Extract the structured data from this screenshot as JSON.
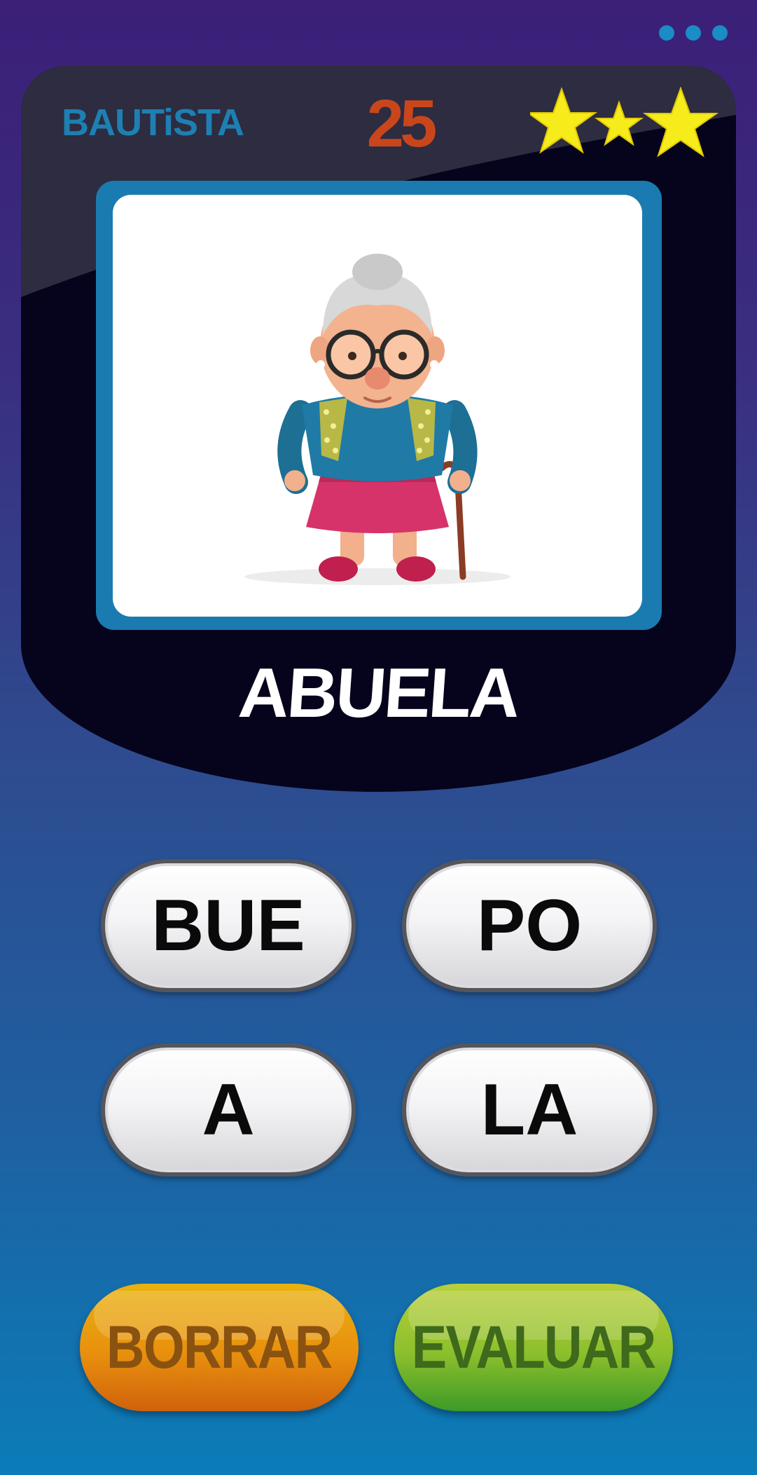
{
  "header": {
    "menu_icon": "more-dots-icon",
    "player_name": "BAUTiSTA",
    "score": "25",
    "stars": {
      "earned": 3,
      "total": 3,
      "color": "#f6ec1b"
    }
  },
  "card": {
    "image": "grandmother-cartoon-illustration",
    "word": "ABUELA"
  },
  "syllables": [
    "BUE",
    "PO",
    "A",
    "LA"
  ],
  "actions": {
    "clear_label": "BORRAR",
    "evaluate_label": "EVALUAR"
  },
  "colors": {
    "accent_blue": "#1e7fb3",
    "score_red": "#c9461c",
    "clear_orange": "#e8900e",
    "evaluate_green": "#8cbf2c"
  }
}
